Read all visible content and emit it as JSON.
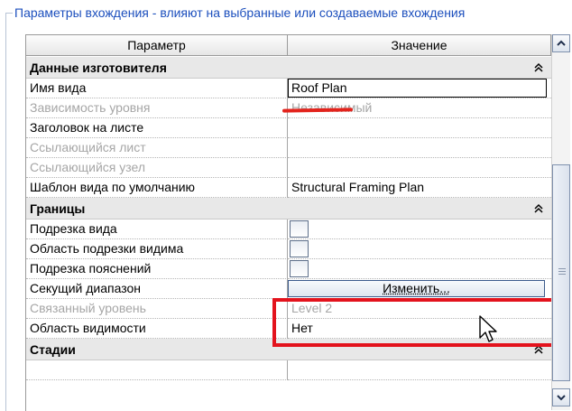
{
  "group": {
    "title": "Параметры вхождения - влияют на выбранные или создаваемые вхождения"
  },
  "table": {
    "header": {
      "param_col": "Параметр",
      "value_col": "Значение"
    },
    "sections": [
      {
        "title": "Данные изготовителя",
        "rows": [
          {
            "param": "Имя вида",
            "value": "Roof Plan",
            "enabled": true,
            "editing": true
          },
          {
            "param": "Зависимость уровня",
            "value": "Независимый",
            "enabled": false
          },
          {
            "param": "Заголовок на листе",
            "value": "",
            "enabled": true
          },
          {
            "param": "Ссылающийся лист",
            "value": "",
            "enabled": false
          },
          {
            "param": "Ссылающийся узел",
            "value": "",
            "enabled": false
          },
          {
            "param": "Шаблон вида по умолчанию",
            "value": "Structural Framing Plan",
            "enabled": true
          }
        ]
      },
      {
        "title": "Границы",
        "rows": [
          {
            "param": "Подрезка вида",
            "value": "",
            "checkbox": true,
            "checked": false
          },
          {
            "param": "Область подрезки видима",
            "value": "",
            "checkbox": true,
            "checked": false
          },
          {
            "param": "Подрезка пояснений",
            "value": "",
            "checkbox": true,
            "checked": false
          },
          {
            "param": "Секущий диапазон",
            "button": "Изменить..."
          },
          {
            "param": "Связанный уровень",
            "value": "Level 2",
            "enabled": false
          },
          {
            "param": "Область видимости",
            "value": "Нет",
            "enabled": true
          }
        ]
      },
      {
        "title": "Стадии",
        "rows": []
      }
    ]
  },
  "icons": {
    "collapse": "double-chevron-up-icon",
    "scroll_up": "scroll-up-arrow-icon",
    "scroll_down": "scroll-down-arrow-icon",
    "cursor": "mouse-pointer-icon"
  },
  "colors": {
    "highlight_red": "#e3131d",
    "title_blue": "#1c4fbd",
    "disabled_text": "#a6a6a6"
  }
}
